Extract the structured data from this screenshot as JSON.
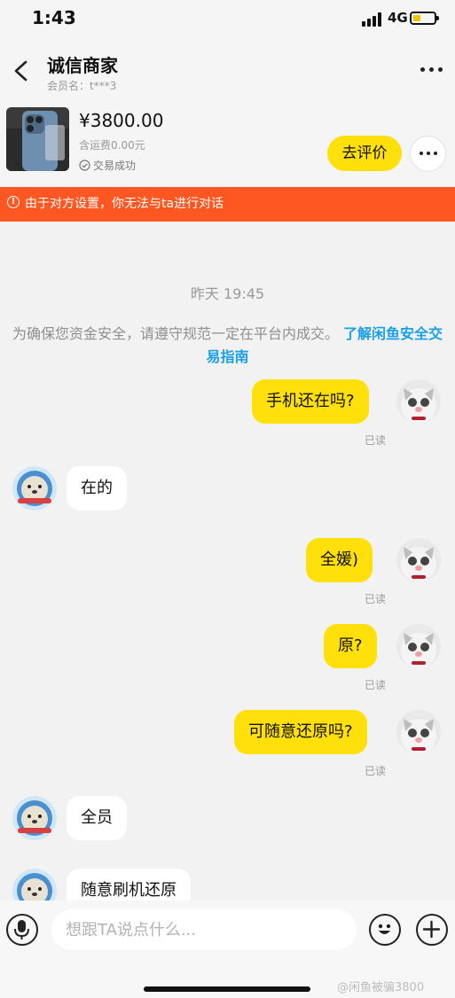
{
  "status_bar": {
    "time": "1:43",
    "network": "4G"
  },
  "header": {
    "title": "诚信商家",
    "member_label": "会员名：t***3"
  },
  "product": {
    "price": "¥3800.00",
    "shipping": "含运费0.00元",
    "status": "交易成功",
    "review_button": "去评价"
  },
  "banner": {
    "text": "由于对方设置，你无法与ta进行对话"
  },
  "chat": {
    "timestamp": "昨天 19:45",
    "notice": "为确保您资金安全，请遵守规范一定在平台内成交。",
    "notice_link": "了解闲鱼安全交易指南",
    "messages": [
      {
        "side": "mine",
        "text": "手机还在吗?",
        "status": "已读"
      },
      {
        "side": "theirs",
        "text": "在的"
      },
      {
        "side": "mine",
        "text": "全媛)",
        "status": "已读"
      },
      {
        "side": "mine",
        "text": "原?",
        "status": "已读"
      },
      {
        "side": "mine",
        "text": "可随意还原吗?",
        "status": "已读"
      },
      {
        "side": "theirs",
        "text": "全员"
      },
      {
        "side": "theirs",
        "text": "随意刷机还原"
      }
    ]
  },
  "input": {
    "placeholder": "想跟TA说点什么..."
  },
  "watermark": "@闲鱼被骗3800",
  "colors": {
    "accent": "#ffe00b",
    "banner": "#ff5722",
    "link": "#1aa0e6"
  }
}
